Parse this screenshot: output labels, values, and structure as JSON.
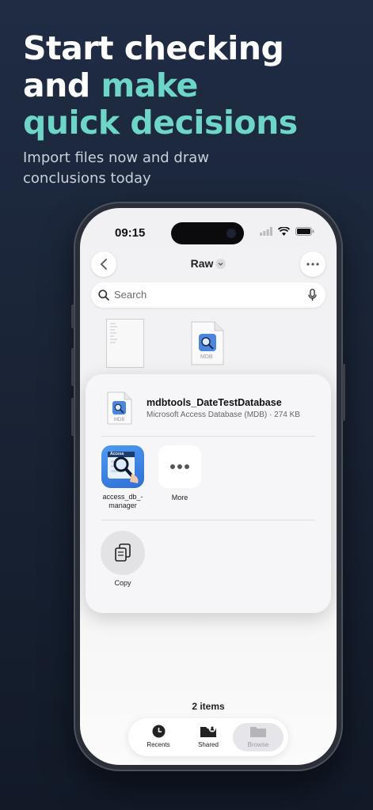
{
  "promo": {
    "headline_part1": "Start checking",
    "headline_part2": "and ",
    "headline_accent1": "make",
    "headline_accent2": "quick decisions",
    "subhead": "Import files now and draw conclusions today",
    "accent_color": "#6ed6c9"
  },
  "status_bar": {
    "time": "09:15"
  },
  "nav": {
    "title": "Raw",
    "back_icon": "chevron-left-icon",
    "more_icon": "ellipsis-icon"
  },
  "search": {
    "placeholder": "Search"
  },
  "background_files": {
    "mdb_badge": "MDB"
  },
  "share_sheet": {
    "file_name": "mdbtools_DateTestDatabase",
    "file_meta": "Microsoft Access Database (MDB) · 274 KB",
    "file_badge": "MDB",
    "apps": [
      {
        "label": "access_db_-\nmanager",
        "badge": "Access"
      },
      {
        "label": "More"
      }
    ],
    "actions": [
      {
        "label": "Copy"
      }
    ]
  },
  "footer": {
    "items_count": "2 items"
  },
  "tabs": [
    {
      "label": "Recents",
      "icon": "clock-icon"
    },
    {
      "label": "Shared",
      "icon": "shared-folder-icon"
    },
    {
      "label": "Browse",
      "icon": "folder-icon"
    }
  ]
}
